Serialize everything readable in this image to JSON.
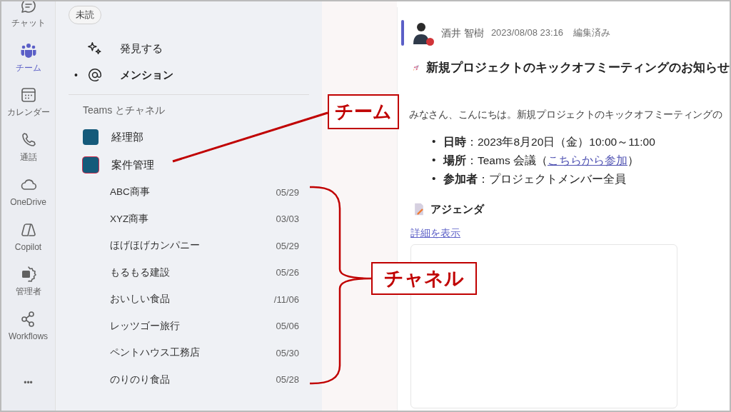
{
  "rail": {
    "items": [
      {
        "kind": "chat",
        "label": "チャット",
        "selected": false
      },
      {
        "kind": "teams",
        "label": "チーム",
        "selected": true
      },
      {
        "kind": "calendar",
        "label": "カレンダー",
        "selected": false
      },
      {
        "kind": "calls",
        "label": "通話",
        "selected": false
      },
      {
        "kind": "cloud",
        "label": "OneDrive",
        "selected": false
      },
      {
        "kind": "copilot",
        "label": "Copilot",
        "selected": false
      },
      {
        "kind": "admin",
        "label": "管理者",
        "selected": false
      },
      {
        "kind": "workflows",
        "label": "Workflows",
        "selected": false
      },
      {
        "kind": "more",
        "label": "•••",
        "selected": false
      }
    ]
  },
  "filters": [
    {
      "label": "未読"
    }
  ],
  "nav_items": [
    {
      "kind": "discover",
      "label": "発見する",
      "unread": false
    },
    {
      "kind": "mention",
      "label": "メンション",
      "unread": true,
      "marker": "•"
    }
  ],
  "teams_section": {
    "heading": "Teams とチャネル",
    "teams": [
      {
        "name": "経理部",
        "selected": false
      },
      {
        "name": "案件管理",
        "selected": true
      }
    ],
    "channels": [
      {
        "name": "ABC商事",
        "date": "05/29"
      },
      {
        "name": "XYZ商事",
        "date": "03/03"
      },
      {
        "name": "ほげほげカンパニー",
        "date": "05/29"
      },
      {
        "name": "もるもる建設",
        "date": "05/26"
      },
      {
        "name": "おいしい食品",
        "date": "/11/06"
      },
      {
        "name": "レッツゴー旅行",
        "date": "05/06"
      },
      {
        "name": "ペントハウス工務店",
        "date": "05/30"
      },
      {
        "name": "のりのり食品",
        "date": "05/28"
      }
    ]
  },
  "message": {
    "author": "酒井 智樹",
    "timestamp": "2023/08/08 23:16",
    "edited": "編集済み",
    "title": "新規プロジェクトのキックオフミーティングのお知らせ",
    "greeting": "みなさん、こんにちは。新規プロジェクトのキックオフミーティングの",
    "details": [
      {
        "marker": "•",
        "text": "**日時**：2023年8月20日（金）10:00～11:00"
      },
      {
        "marker": "•",
        "text": "**場所**：Teams 会議（",
        "link": "こちらから参加",
        "after": "）"
      },
      {
        "marker": "•",
        "text": "**参加者**：プロジェクトメンバー全員"
      }
    ],
    "agenda": "アジェンダ",
    "show_more": "詳細を表示"
  },
  "annotations": [
    {
      "kind": "team",
      "label": "チーム"
    },
    {
      "kind": "channel",
      "label": "チャネル"
    }
  ]
}
